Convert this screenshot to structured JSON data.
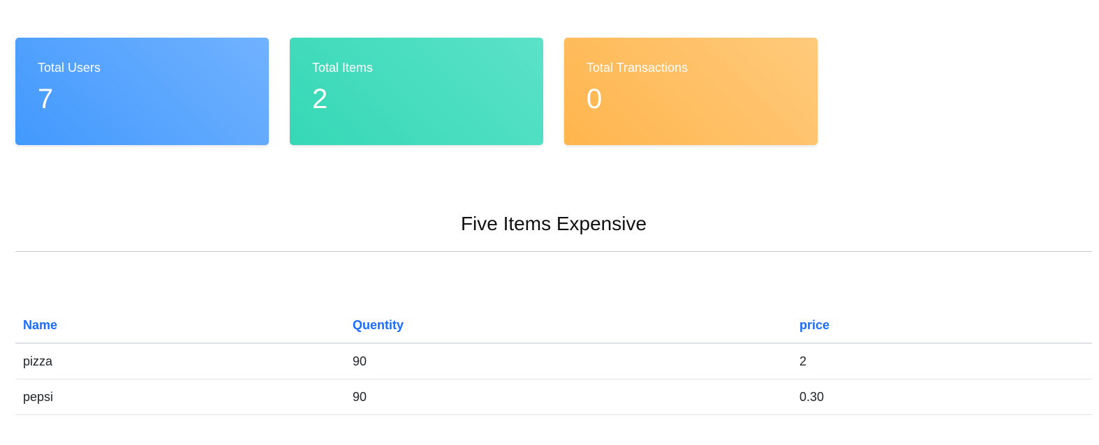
{
  "stats": [
    {
      "label": "Total Users",
      "value": "7",
      "color": "#4299fd"
    },
    {
      "label": "Total Items",
      "value": "2",
      "color": "#35d8b6"
    },
    {
      "label": "Total Transactions",
      "value": "0",
      "color": "#ffb54d"
    }
  ],
  "section_title": "Five Items Expensive",
  "table": {
    "headers": [
      "Name",
      "Quentity",
      "price"
    ],
    "rows": [
      [
        "pizza",
        "90",
        "2"
      ],
      [
        "pepsi",
        "90",
        "0.30"
      ]
    ]
  }
}
